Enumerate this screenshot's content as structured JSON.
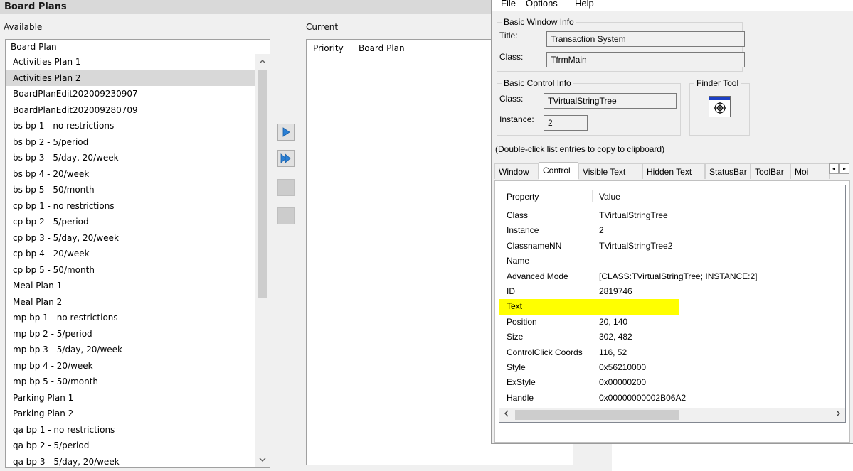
{
  "board_plans": {
    "title": "Board Plans",
    "available_label": "Available",
    "current_label": "Current",
    "available_header": "Board Plan",
    "available_items": [
      "Activities Plan 1",
      "Activities Plan 2",
      "BoardPlanEdit202009230907",
      "BoardPlanEdit202009280709",
      "bs bp 1 - no restrictions",
      "bs bp 2 - 5/period",
      "bs bp 3 - 5/day, 20/week",
      "bs bp 4 - 20/week",
      "bs bp 5 - 50/month",
      "cp bp 1 - no restrictions",
      "cp bp 2 - 5/period",
      "cp bp 3 - 5/day, 20/week",
      "cp bp 4 - 20/week",
      "cp bp 5 - 50/month",
      "Meal Plan 1",
      "Meal Plan 2",
      "mp bp 1 - no restrictions",
      "mp bp 2 - 5/period",
      "mp bp 3 - 5/day, 20/week",
      "mp bp 4 - 20/week",
      "mp bp 5 - 50/month",
      "Parking Plan 1",
      "Parking Plan 2",
      "qa bp 1 - no restrictions",
      "qa bp 2 - 5/period",
      "qa bp 3 - 5/day, 20/week"
    ],
    "selected_item": "Activities Plan 2",
    "current_columns": [
      "Priority",
      "Board Plan"
    ]
  },
  "info_window": {
    "menu": [
      "File",
      "Options",
      "Help"
    ],
    "basic_window": {
      "title": "Basic Window Info",
      "title_label": "Title:",
      "title_value": "Transaction System",
      "class_label": "Class:",
      "class_value": "TfrmMain"
    },
    "basic_control": {
      "title": "Basic Control Info",
      "class_label": "Class:",
      "class_value": "TVirtualStringTree",
      "instance_label": "Instance:",
      "instance_value": "2"
    },
    "finder_tool": {
      "title": "Finder Tool"
    },
    "hint": "(Double-click list entries to copy to clipboard)",
    "tabs": [
      "Window",
      "Control",
      "Visible Text",
      "Hidden Text",
      "StatusBar",
      "ToolBar",
      "Moi"
    ],
    "active_tab": "Control",
    "table_headers": {
      "property": "Property",
      "value": "Value"
    },
    "properties": [
      {
        "name": "Class",
        "value": "TVirtualStringTree"
      },
      {
        "name": "Instance",
        "value": "2"
      },
      {
        "name": "ClassnameNN",
        "value": "TVirtualStringTree2"
      },
      {
        "name": "Name",
        "value": ""
      },
      {
        "name": "Advanced Mode",
        "value": "[CLASS:TVirtualStringTree; INSTANCE:2]"
      },
      {
        "name": "ID",
        "value": "2819746"
      },
      {
        "name": "Text",
        "value": ""
      },
      {
        "name": "Position",
        "value": "20, 140"
      },
      {
        "name": "Size",
        "value": "302, 482"
      },
      {
        "name": "ControlClick Coords",
        "value": "116, 52"
      },
      {
        "name": "Style",
        "value": "0x56210000"
      },
      {
        "name": "ExStyle",
        "value": "0x00000200"
      },
      {
        "name": "Handle",
        "value": "0x00000000002B06A2"
      }
    ],
    "highlighted_property": "Text"
  },
  "colors": {
    "highlight": "#ffff00",
    "selection": "#d8d8d8",
    "button_arrow": "#2a7fd4",
    "finder_bar": "#1c3fc4"
  },
  "icons": {
    "add": "triangle-right-icon",
    "add_all": "double-triangle-right-icon",
    "finder": "crosshair-target-icon"
  }
}
